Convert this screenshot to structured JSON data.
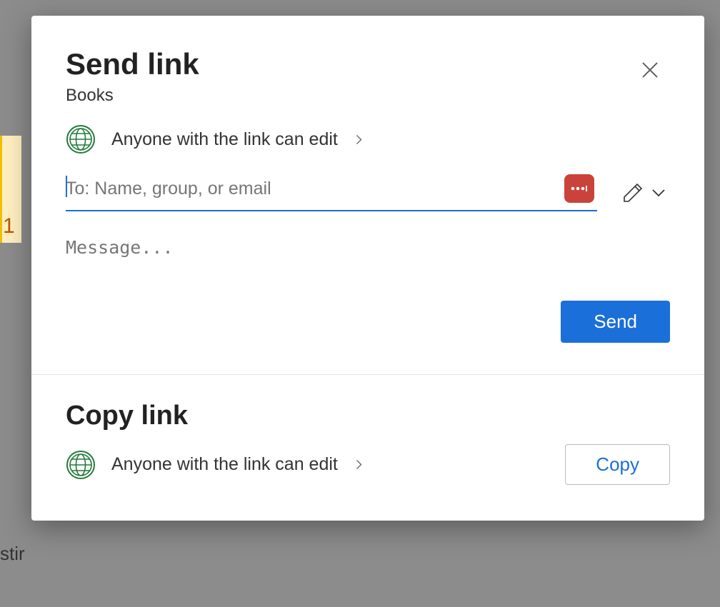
{
  "background": {
    "row_number": "1",
    "truncated_text": "stir"
  },
  "dialog": {
    "title": "Send link",
    "subtitle": "Books",
    "send_section": {
      "permission_label": "Anyone with the link can edit",
      "recipient_placeholder": "To: Name, group, or email",
      "recipient_value": "",
      "message_placeholder": "Message...",
      "message_value": "",
      "send_button_label": "Send"
    },
    "copy_section": {
      "title": "Copy link",
      "permission_label": "Anyone with the link can edit",
      "copy_button_label": "Copy"
    }
  }
}
